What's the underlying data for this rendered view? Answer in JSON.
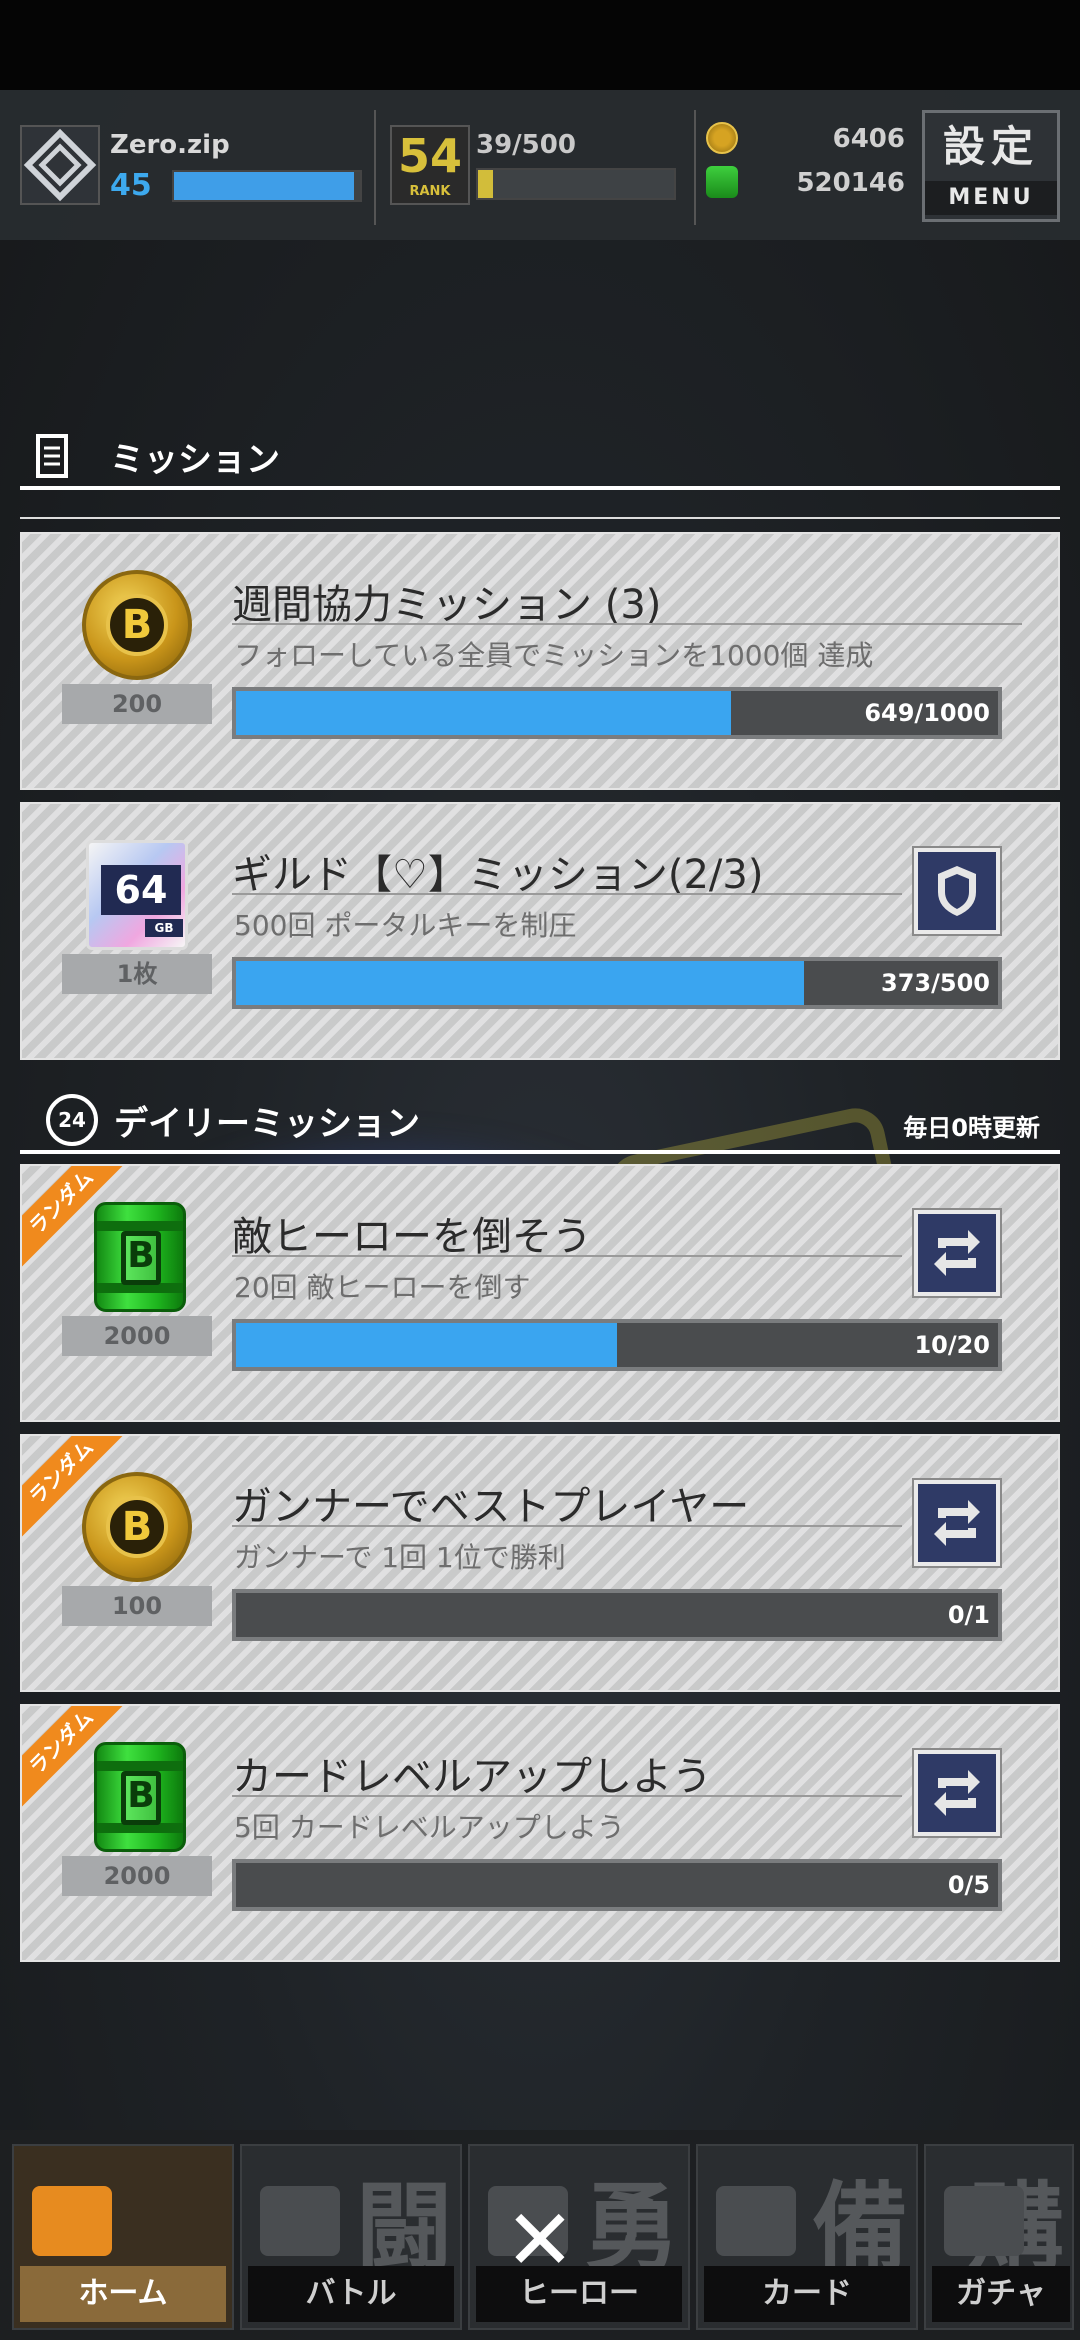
{
  "player": {
    "name": "Zero.zip",
    "level": "45",
    "exp_fraction": 0.97
  },
  "rank": {
    "number": "54",
    "label": "RANK",
    "progress_text": "39/500",
    "fraction": 0.078
  },
  "currency": {
    "gold": "6406",
    "green": "520146"
  },
  "menu": {
    "kanji": "設定",
    "label": "MENU"
  },
  "mission_section": {
    "title": "ミッション"
  },
  "daily_section": {
    "title": "デイリーミッション",
    "refresh_note": "毎日0時更新",
    "badge": "24"
  },
  "missions": [
    {
      "title": "週間協力ミッション (3)",
      "desc": "フォローしている全員でミッションを1000個 達成",
      "reward_count": "200",
      "progress_text": "649/1000",
      "fraction": 0.649,
      "reward_icon": "gold-coin-icon",
      "coin_letter": "B"
    },
    {
      "title": "ギルド【♡】ミッション(2/3)",
      "desc": "500回 ポータルキーを制圧",
      "reward_count": "1枚",
      "progress_text": "373/500",
      "fraction": 0.746,
      "reward_icon": "64gb-card-icon",
      "card_num": "64",
      "card_unit": "GB"
    }
  ],
  "daily_missions": [
    {
      "tag": "ランダム",
      "title": "敵ヒーローを倒そう",
      "desc": "20回 敵ヒーローを倒す",
      "reward_count": "2000",
      "progress_text": "10/20",
      "fraction": 0.5,
      "reward_icon": "green-can-icon",
      "coin_letter": "B"
    },
    {
      "tag": "ランダム",
      "title": "ガンナーでベストプレイヤー",
      "desc": "ガンナーで 1回 1位で勝利",
      "reward_count": "100",
      "progress_text": "0/1",
      "fraction": 0,
      "reward_icon": "gold-coin-icon",
      "coin_letter": "B"
    },
    {
      "tag": "ランダム",
      "title": "カードレベルアップしよう",
      "desc": "5回 カードレベルアップしよう",
      "reward_count": "2000",
      "progress_text": "0/5",
      "fraction": 0,
      "reward_icon": "green-can-icon",
      "coin_letter": "B"
    }
  ],
  "nav": [
    {
      "kanji": "",
      "label": "ホーム",
      "icon": "home-icon"
    },
    {
      "kanji": "闘",
      "label": "バトル",
      "icon": "gamepad-icon"
    },
    {
      "kanji": "勇",
      "label": "ヒーロー",
      "icon": "hero-icon"
    },
    {
      "kanji": "備",
      "label": "カード",
      "icon": "card-icon"
    },
    {
      "kanji": "購",
      "label": "ガチャ",
      "icon": "gacha-icon"
    }
  ],
  "close_symbol": "✕"
}
